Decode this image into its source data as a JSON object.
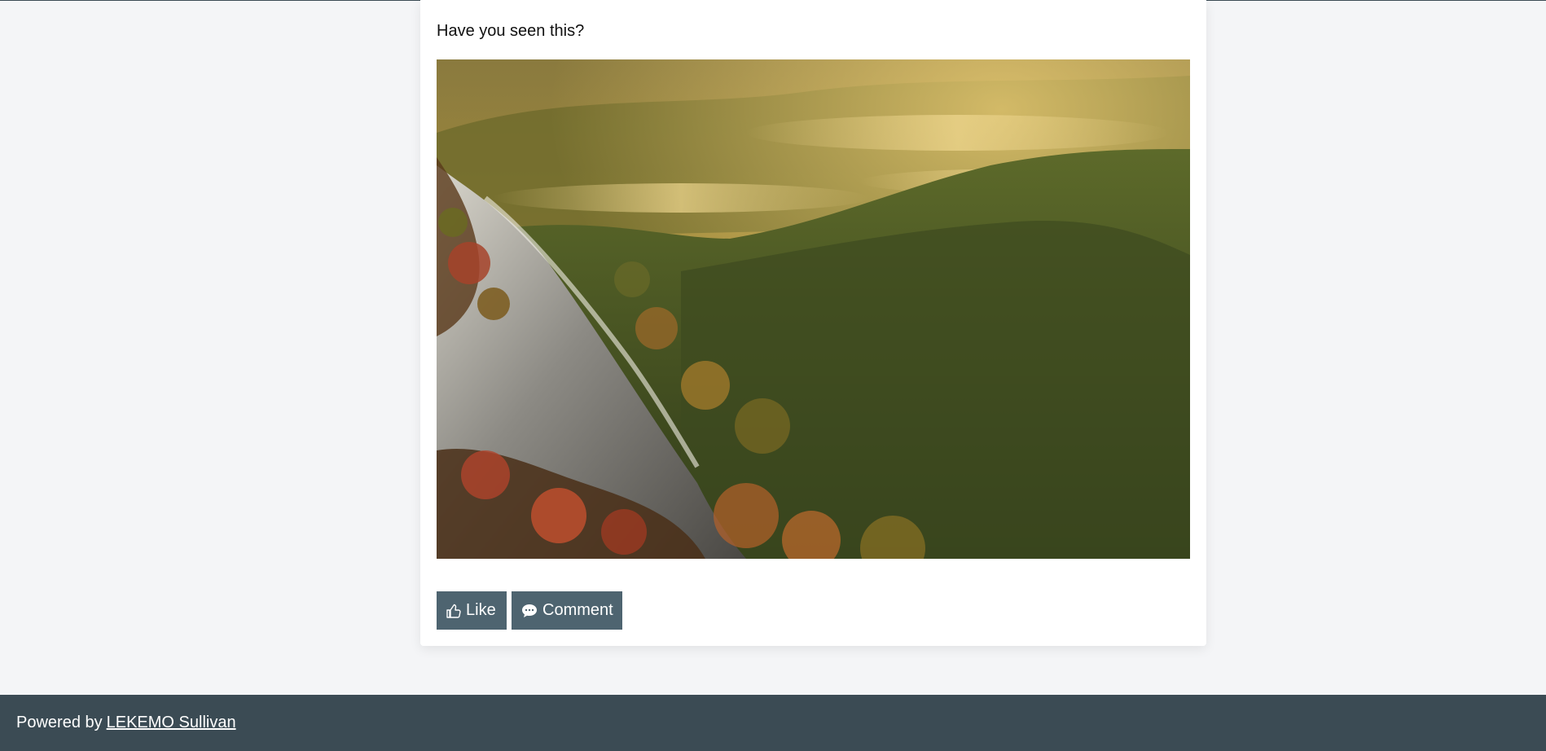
{
  "post": {
    "text": "Have you seen this?",
    "photo_icon": "autumn-forest-mountain-photo"
  },
  "actions": {
    "like_label": "Like",
    "like_icon": "thumbs-up-icon",
    "comment_label": "Comment",
    "comment_icon": "speech-bubble-icon"
  },
  "footer": {
    "prefix": "Powered by",
    "link_text": "LEKEMO Sullivan"
  },
  "colors": {
    "page_bg": "#f4f5f7",
    "card_bg": "#ffffff",
    "button_bg": "#4e6470",
    "footer_bg": "#3b4b54"
  }
}
